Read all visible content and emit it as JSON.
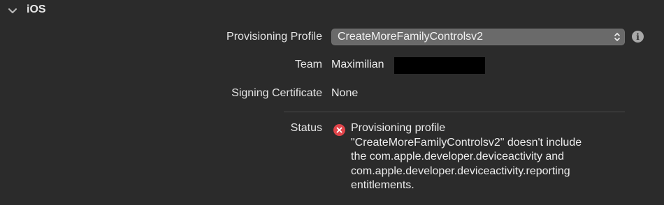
{
  "section": {
    "title": "iOS"
  },
  "signing": {
    "provisioning_profile": {
      "label": "Provisioning Profile",
      "value": "CreateMoreFamilyControlsv2"
    },
    "team": {
      "label": "Team",
      "value": "Maximilian"
    },
    "signing_certificate": {
      "label": "Signing Certificate",
      "value": "None"
    },
    "status": {
      "label": "Status",
      "message": "Provisioning profile\n\"CreateMoreFamilyControlsv2\" doesn't include\nthe com.apple.developer.deviceactivity and\ncom.apple.developer.deviceactivity.reporting\nentitlements."
    }
  },
  "icons": {
    "section_toggle": "chevron-down-icon",
    "popup_arrows": "up-down-arrows-icon",
    "info": "info-icon",
    "status": "error-icon"
  },
  "colors": {
    "background": "#2b2b2b",
    "popup": "#6a6a6a",
    "error": "#e0444a"
  }
}
